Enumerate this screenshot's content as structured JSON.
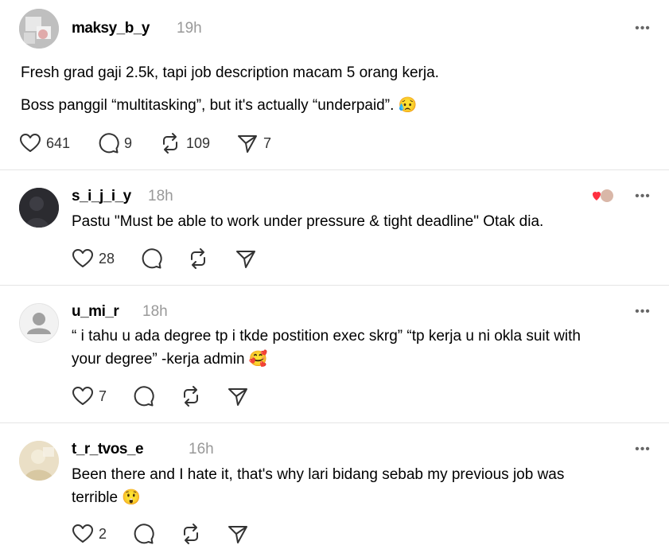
{
  "posts": [
    {
      "username": "maksy_b_y",
      "time": "19h",
      "lines": [
        "Fresh grad gaji 2.5k, tapi job description macam 5 orang kerja.",
        "Boss panggil “multitasking”, but it's actually “underpaid”. 😥"
      ],
      "likes": "641",
      "replies": "9",
      "reposts": "109",
      "shares": "7"
    },
    {
      "username": "s_i_j_i_y",
      "time": "18h",
      "lines": [
        "Pastu \"Must be able to work under pressure & tight deadline\" Otak dia."
      ],
      "likes": "28"
    },
    {
      "username": "u_mi_r",
      "time": "18h",
      "lines": [
        "“ i tahu u ada degree tp i tkde postition exec skrg” “tp kerja u ni okla suit with",
        "your degree” -kerja admin 🥰"
      ],
      "likes": "7"
    },
    {
      "username": "t_r_tvos_e",
      "time": "16h",
      "lines": [
        "Been there and I hate it, that's why lari bidang sebab my previous job was",
        "terrible 😲"
      ],
      "likes": "2"
    }
  ],
  "icons": {
    "like": "heart-icon",
    "reply": "comment-icon",
    "repost": "repost-icon",
    "share": "send-icon",
    "more": "more-icon",
    "reactions": "reactions-icon"
  },
  "colors": {
    "text": "#000000",
    "muted": "#999999",
    "icon": "#333333",
    "divider": "#e5e5e5",
    "heart_red": "#ff3040"
  },
  "more_glyph": "•••"
}
